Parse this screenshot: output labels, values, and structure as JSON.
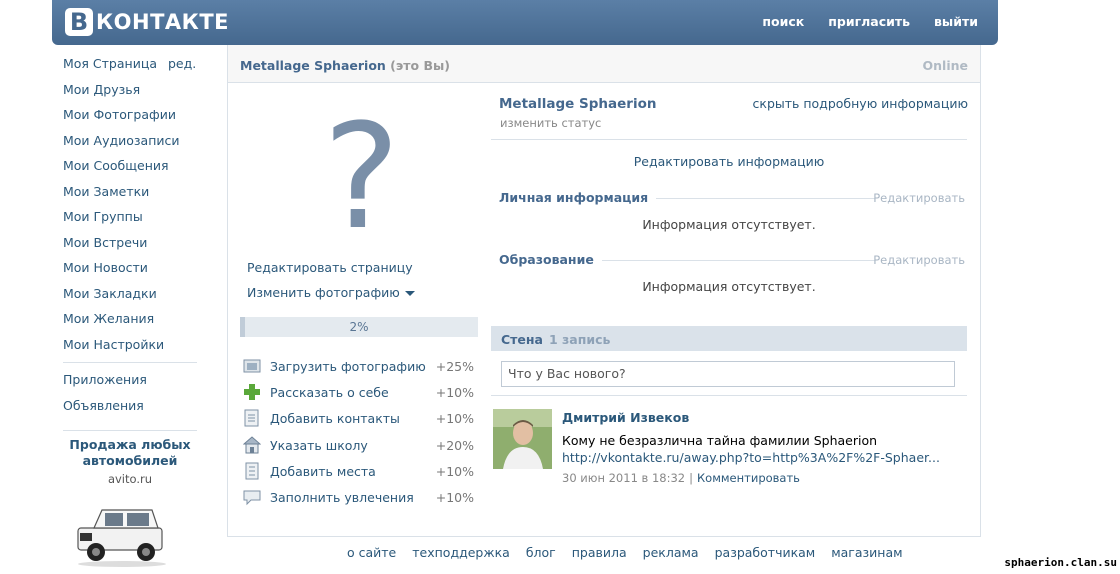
{
  "header": {
    "logo_letter": "В",
    "logo_word": "КОНТАКТЕ",
    "nav": [
      "поиск",
      "пригласить",
      "выйти"
    ]
  },
  "leftnav": {
    "items": [
      "Моя Страница",
      "Мои Друзья",
      "Мои Фотографии",
      "Мои Аудиозаписи",
      "Мои Сообщения",
      "Мои Заметки",
      "Мои Группы",
      "Мои Встречи",
      "Мои Новости",
      "Мои Закладки",
      "Мои Желания",
      "Мои Настройки"
    ],
    "edit_label": "ред.",
    "extra": [
      "Приложения",
      "Объявления"
    ]
  },
  "ad": {
    "title": "Продажа любых автомобилей",
    "site": "avito.ru"
  },
  "profile": {
    "name": "Metallage Sphaerion",
    "me_label": "(это Вы)",
    "online": "Online",
    "avatar_glyph": "?",
    "edit_page": "Редактировать страницу",
    "change_photo": "Изменить фотографию",
    "progress": {
      "label": "2%",
      "value": 2
    },
    "tasks": [
      {
        "icon": "photo-upload-icon",
        "label": "Загрузить фотографию",
        "pct": "+25%"
      },
      {
        "icon": "plus-icon",
        "label": "Рассказать о себе",
        "pct": "+10%"
      },
      {
        "icon": "contacts-icon",
        "label": "Добавить контакты",
        "pct": "+10%"
      },
      {
        "icon": "school-icon",
        "label": "Указать школу",
        "pct": "+20%"
      },
      {
        "icon": "places-icon",
        "label": "Добавить места",
        "pct": "+10%"
      },
      {
        "icon": "interests-icon",
        "label": "Заполнить увлечения",
        "pct": "+10%"
      }
    ]
  },
  "info": {
    "name": "Metallage Sphaerion",
    "change_status": "изменить статус",
    "hide_details": "скрыть подробную информацию",
    "edit_info": "Редактировать информацию",
    "sections": [
      {
        "title": "Личная информация",
        "edit": "Редактировать",
        "empty": "Информация отсутствует."
      },
      {
        "title": "Образование",
        "edit": "Редактировать",
        "empty": "Информация отсутствует."
      }
    ]
  },
  "wall": {
    "title": "Стена",
    "count": "1 запись",
    "placeholder": "Что у Вас нового?",
    "post": {
      "author": "Дмитрий Извеков",
      "text": "Кому не безразлична тайна фамилии Sphaerion",
      "link": "http://vkontakte.ru/away.php?to=http%3A%2F%2F-Sphaer...",
      "date": "30 июн 2011 в 18:32",
      "comment": "Комментировать"
    }
  },
  "footer": [
    "о сайте",
    "техподдержка",
    "блог",
    "правила",
    "реклама",
    "разработчикам",
    "магазинам"
  ],
  "watermark": "sphaerion.clan.su"
}
